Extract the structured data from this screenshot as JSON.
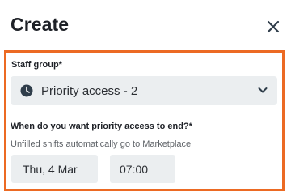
{
  "header": {
    "title": "Create",
    "close_icon": "close-icon"
  },
  "accent_color": "#ec6a23",
  "form": {
    "staff_group": {
      "label": "Staff group*",
      "value": "Priority access - 2",
      "icon": "clock-icon",
      "dropdown_icon": "chevron-down-icon"
    },
    "priority_end": {
      "label": "When do you want priority access to end?*",
      "hint": "Unfilled shifts automatically go to Marketplace",
      "date": "Thu, 4 Mar",
      "time": "07:00"
    }
  }
}
